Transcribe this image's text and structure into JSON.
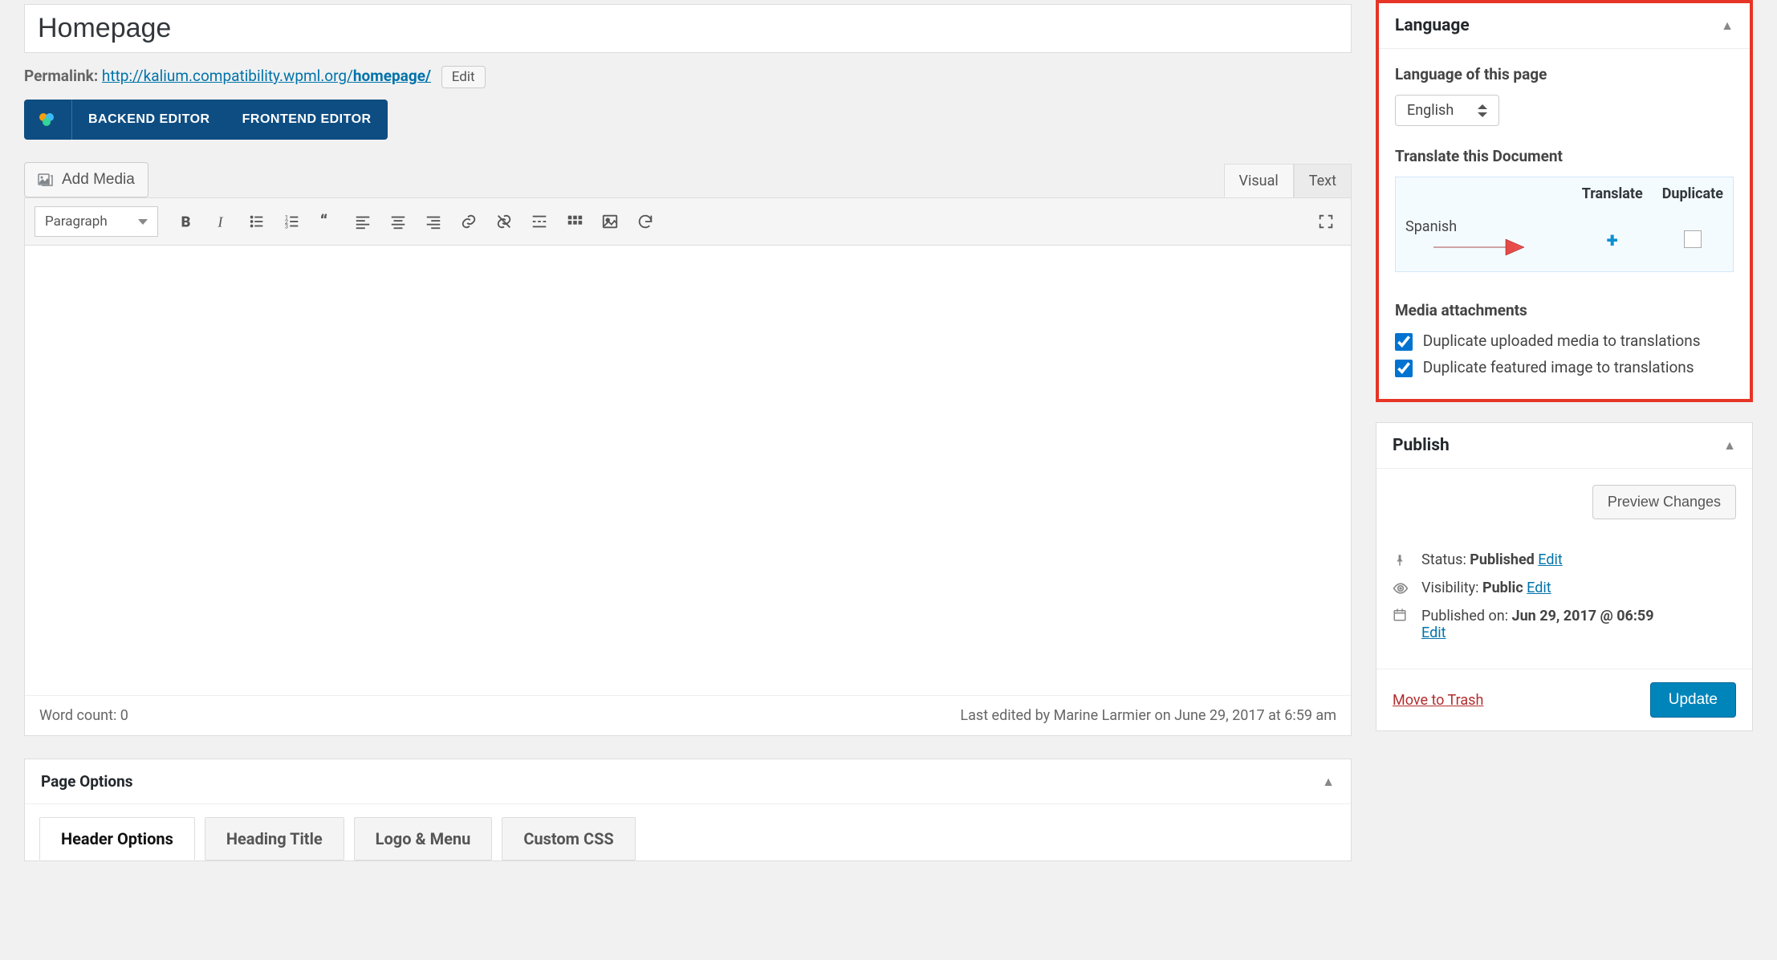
{
  "title": "Homepage",
  "permalink": {
    "label": "Permalink:",
    "base": "http://kalium.compatibility.wpml.org/",
    "slug": "homepage/",
    "edit": "Edit"
  },
  "editorModes": {
    "backend": "BACKEND EDITOR",
    "frontend": "FRONTEND EDITOR"
  },
  "addMedia": "Add Media",
  "contentTabs": {
    "visual": "Visual",
    "text": "Text"
  },
  "formatSelect": "Paragraph",
  "footer": {
    "wordCountLabel": "Word count: 0",
    "lastEdited": "Last edited by Marine Larmier on June 29, 2017 at 6:59 am"
  },
  "pageOptions": {
    "title": "Page Options",
    "tabs": [
      "Header Options",
      "Heading Title",
      "Logo & Menu",
      "Custom CSS"
    ]
  },
  "language": {
    "panelTitle": "Language",
    "ofThisPage": "Language of this page",
    "selected": "English",
    "translateDoc": "Translate this Document",
    "headers": {
      "translate": "Translate",
      "duplicate": "Duplicate"
    },
    "rows": [
      {
        "lang": "Spanish"
      }
    ],
    "mediaTitle": "Media attachments",
    "mediaDupUploaded": "Duplicate uploaded media to translations",
    "mediaDupFeatured": "Duplicate featured image to translations"
  },
  "publish": {
    "panelTitle": "Publish",
    "preview": "Preview Changes",
    "statusLabel": "Status:",
    "statusValue": "Published",
    "visibilityLabel": "Visibility:",
    "visibilityValue": "Public",
    "publishedOnLabel": "Published on:",
    "publishedOnValue": "Jun 29, 2017 @ 06:59",
    "edit": "Edit",
    "trash": "Move to Trash",
    "update": "Update"
  }
}
